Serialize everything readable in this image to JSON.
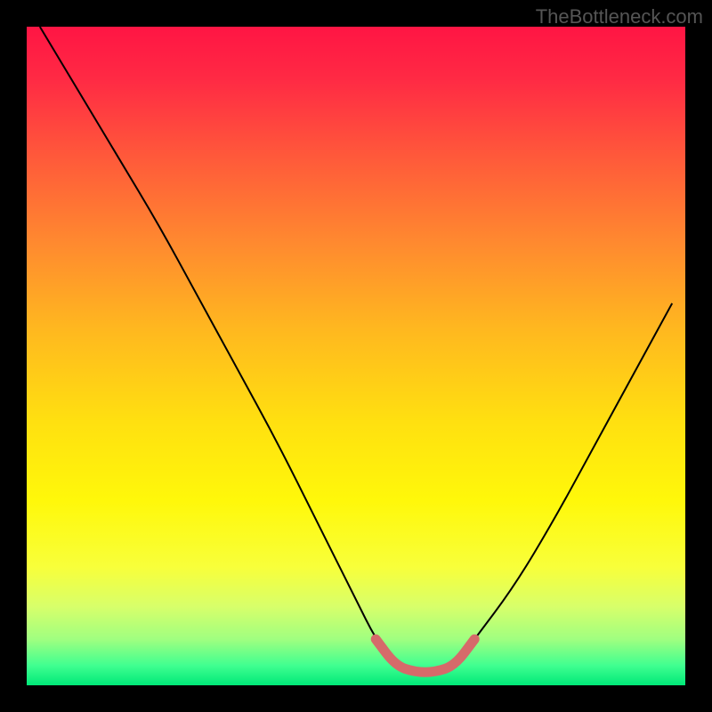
{
  "watermark": "TheBottleneck.com",
  "chart_data": {
    "type": "line",
    "title": "",
    "xlabel": "",
    "ylabel": "",
    "xlim": [
      0,
      100
    ],
    "ylim": [
      0,
      100
    ],
    "grid": false,
    "legend": false,
    "background_gradient": {
      "direction": "top-to-bottom",
      "stops": [
        {
          "pos": 0,
          "color": "#ff1544"
        },
        {
          "pos": 20,
          "color": "#ff5a3a"
        },
        {
          "pos": 46,
          "color": "#ffb81f"
        },
        {
          "pos": 72,
          "color": "#fff80a"
        },
        {
          "pos": 93,
          "color": "#a0ff80"
        },
        {
          "pos": 100,
          "color": "#00e878"
        }
      ]
    },
    "series": [
      {
        "name": "bottleneck-curve",
        "color": "#000000",
        "x": [
          2,
          8,
          14,
          20,
          26,
          32,
          38,
          44,
          50,
          53,
          56,
          59,
          62,
          65,
          68,
          74,
          80,
          86,
          92,
          98
        ],
        "y": [
          100,
          90,
          80,
          70,
          59,
          48,
          37,
          25,
          13,
          7,
          3,
          2,
          2,
          3,
          7,
          15,
          25,
          36,
          47,
          58
        ]
      }
    ],
    "highlight_region": {
      "name": "optimal-range",
      "color": "#d66a6a",
      "x_start": 53,
      "x_end": 67,
      "y_approx": 3
    }
  }
}
